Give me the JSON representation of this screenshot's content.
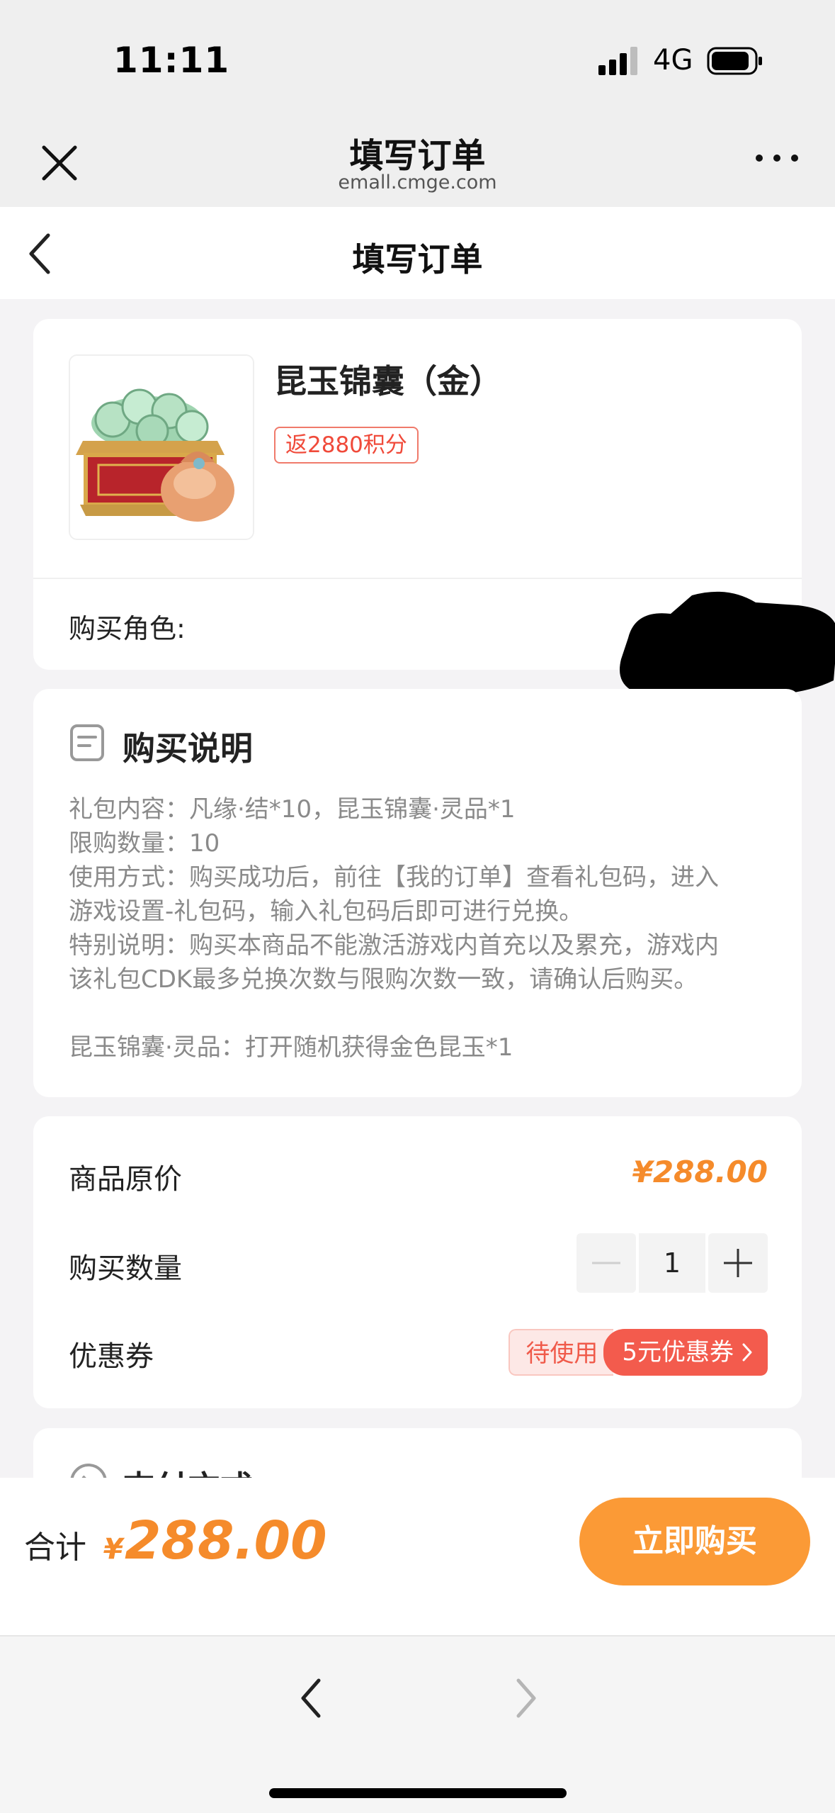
{
  "status_bar": {
    "time": "11:11",
    "network": "4G"
  },
  "webview": {
    "title": "填写订单",
    "url": "emall.cmge.com"
  },
  "page": {
    "title": "填写订单"
  },
  "product": {
    "name": "昆玉锦囊（金）",
    "points_badge": "返2880积分",
    "role_label": "购买角色:"
  },
  "description": {
    "title": "购买说明",
    "lines": [
      "礼包内容：凡缘·结*10，昆玉锦囊·灵品*1",
      "限购数量：10",
      "使用方式：购买成功后，前往【我的订单】查看礼包码，进入",
      "游戏设置-礼包码，输入礼包码后即可进行兑换。",
      "特别说明：购买本商品不能激活游戏内首充以及累充，游戏内",
      "该礼包CDK最多兑换次数与限购次数一致，请确认后购买。"
    ],
    "note": "昆玉锦囊·灵品：打开随机获得金色昆玉*1"
  },
  "pricing": {
    "original_price_label": "商品原价",
    "original_price": "¥288.00",
    "quantity_label": "购买数量",
    "quantity": "1",
    "coupon_label": "优惠券",
    "coupon_status": "待使用",
    "coupon_name": "5元优惠券"
  },
  "payment": {
    "title": "支付方式"
  },
  "bottom": {
    "total_label": "合计",
    "currency": "¥",
    "total": "288.00",
    "buy_label": "立即购买"
  },
  "colors": {
    "accent_orange": "#fb9a36",
    "price_orange": "#f58b2b",
    "coupon_red": "#f35b4d"
  }
}
